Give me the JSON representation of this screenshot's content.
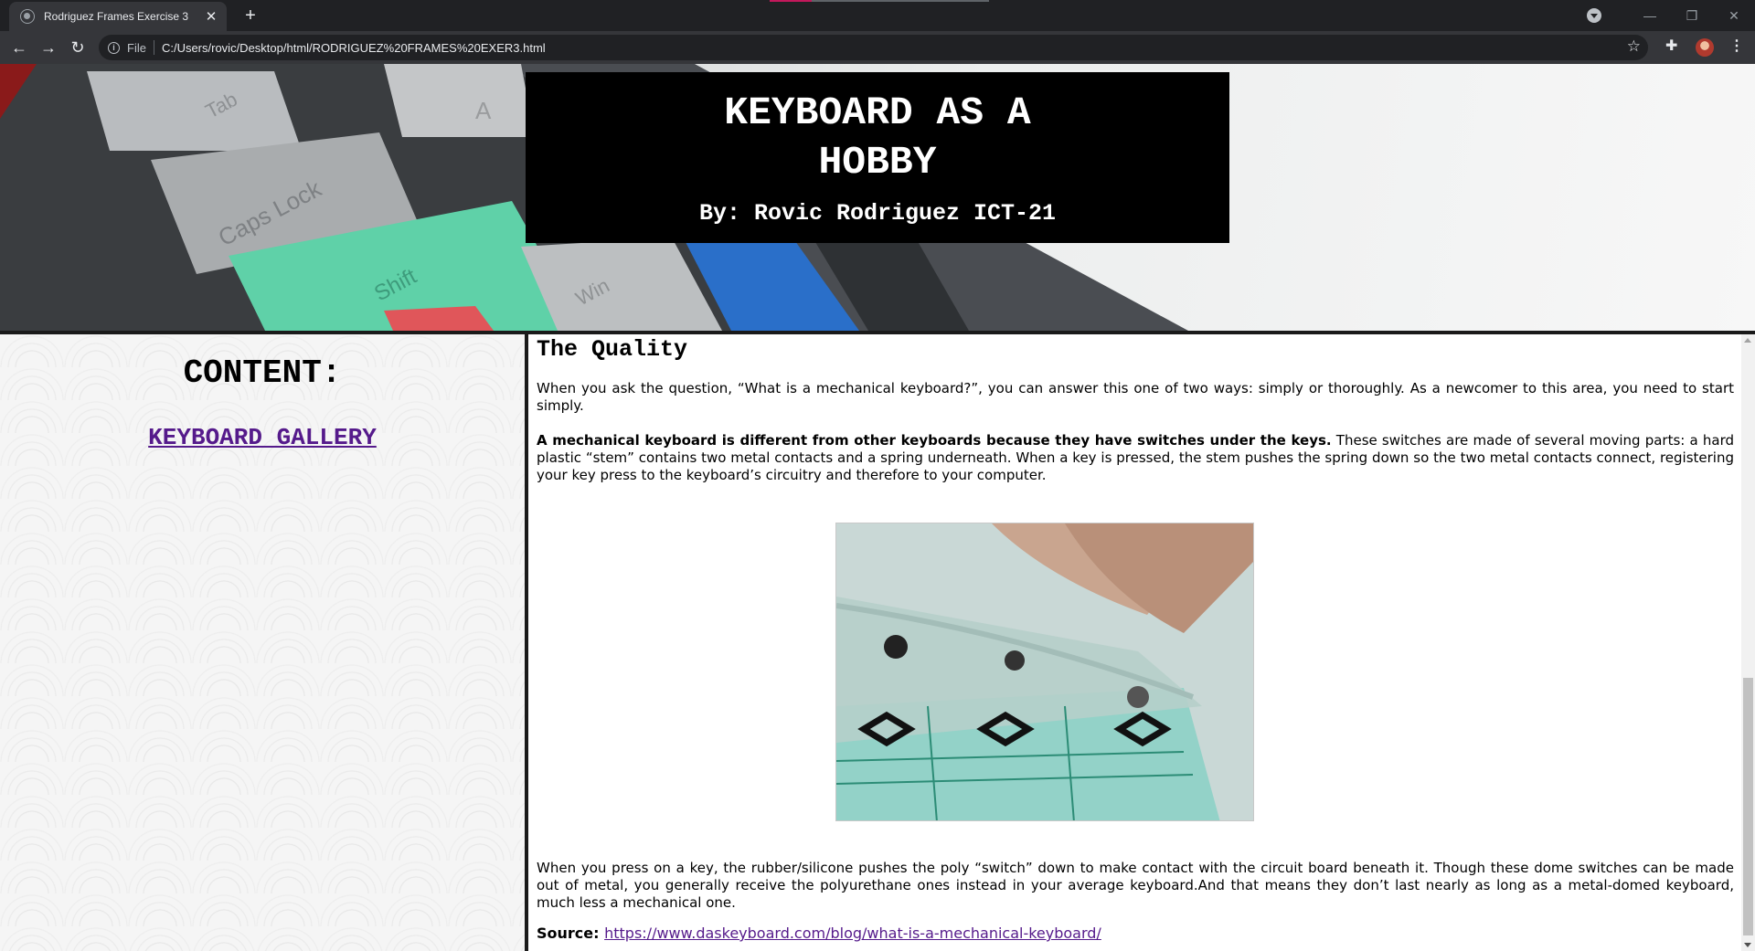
{
  "browser": {
    "tab_title": "Rodriguez Frames Exercise 3",
    "tab_close": "✕",
    "new_tab": "+",
    "scheme": "File",
    "url": "C:/Users/rovic/Desktop/html/RODRIGUEZ%20FRAMES%20EXER3.html",
    "window_controls": {
      "minimize": "—",
      "restore": "❐",
      "close": "✕"
    },
    "nav": {
      "back": "←",
      "forward": "→",
      "reload": "↻"
    },
    "icons": [
      "tab-search-icon",
      "info-icon",
      "star-icon",
      "extensions-icon",
      "profile-avatar",
      "menu-icon"
    ]
  },
  "banner": {
    "title_line1": "KEYBOARD AS A",
    "title_line2": "HOBBY",
    "byline": "By: Rovic Rodriguez ICT-21",
    "keycap_labels": [
      "Tab",
      "Caps Lock",
      "Shift",
      "Win",
      "A"
    ]
  },
  "sidebar": {
    "heading": "CONTENT:",
    "link_label": "KEYBOARD GALLERY"
  },
  "article": {
    "title": "The Quality",
    "p1": "When you ask the question, “What is a mechanical keyboard?”, you can answer this one of two ways: simply or thoroughly. As a newcomer to this area, you need to start simply.",
    "p2_bold": "A mechanical keyboard is different from other keyboards because they have switches under the keys.",
    "p2_rest": " These switches are made of several moving parts: a hard plastic “stem” contains two metal contacts and a spring underneath. When a key is pressed, the stem pushes the spring down so the two metal contacts connect, registering your key press to the keyboard’s circuitry and therefore to your computer.",
    "p3": "When you press on a key, the rubber/silicone pushes the poly “switch” down to make contact with the circuit board beneath it. Though these dome switches can be made out of metal, you generally receive the polyurethane ones instead in your average keyboard.And that means they don’t last nearly as long as a metal-domed keyboard, much less a mechanical one.",
    "source_label": "Source: ",
    "source_url": "https://www.daskeyboard.com/blog/what-is-a-mechanical-keyboard/"
  },
  "colors": {
    "chrome_dark": "#202124",
    "chrome_toolbar": "#35363a",
    "link_visited": "#551a8b",
    "keycap_teal": "#5fd1a8",
    "keycap_blue": "#2a6fc9",
    "keycap_red": "#e0565a"
  }
}
